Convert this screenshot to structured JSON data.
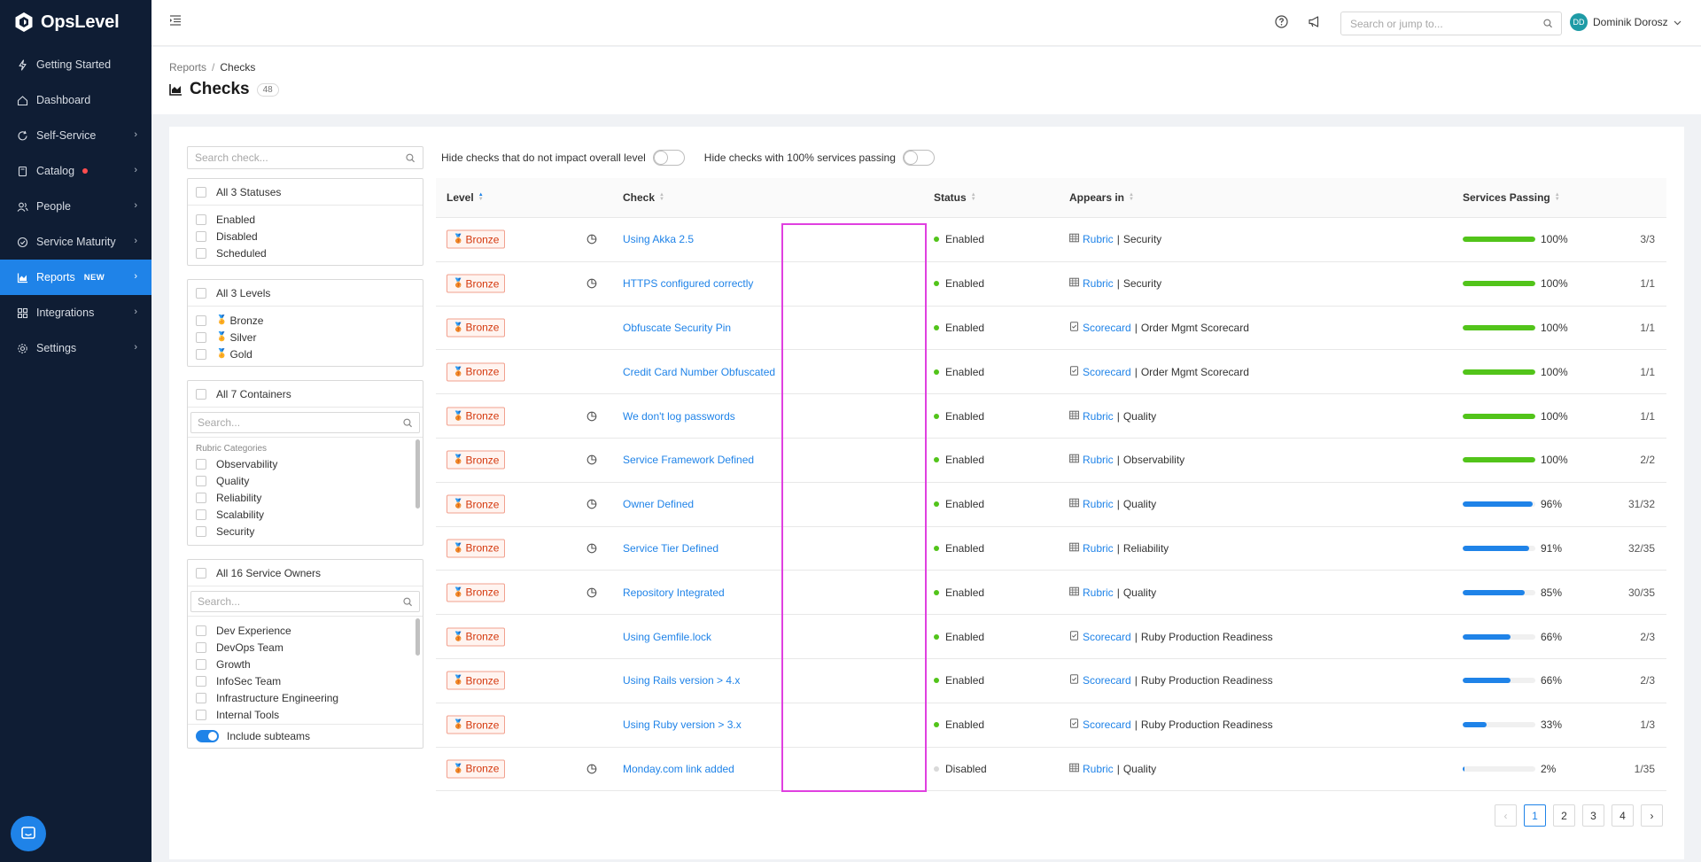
{
  "app": {
    "name": "OpsLevel"
  },
  "sidebar": {
    "items": [
      {
        "label": "Getting Started",
        "icon": "bolt-icon",
        "chevron": false
      },
      {
        "label": "Dashboard",
        "icon": "home-icon",
        "chevron": false
      },
      {
        "label": "Self-Service",
        "icon": "refresh-icon",
        "chevron": true
      },
      {
        "label": "Catalog",
        "icon": "book-icon",
        "chevron": true,
        "dot": true
      },
      {
        "label": "People",
        "icon": "people-icon",
        "chevron": true
      },
      {
        "label": "Service Maturity",
        "icon": "target-icon",
        "chevron": true
      },
      {
        "label": "Reports",
        "icon": "chart-icon",
        "chevron": true,
        "active": true,
        "badge": "NEW"
      },
      {
        "label": "Integrations",
        "icon": "grid-icon",
        "chevron": true
      },
      {
        "label": "Settings",
        "icon": "gear-icon",
        "chevron": true
      }
    ]
  },
  "topbar": {
    "search_placeholder": "Search or jump to...",
    "user_initials": "DD",
    "user_name": "Dominik Dorosz"
  },
  "header": {
    "breadcrumb_parent": "Reports",
    "breadcrumb_separator": "/",
    "breadcrumb_current": "Checks",
    "title": "Checks",
    "count": "48"
  },
  "filters": {
    "search_placeholder": "Search check...",
    "statuses": {
      "all_label": "All 3 Statuses",
      "options": [
        "Enabled",
        "Disabled",
        "Scheduled"
      ]
    },
    "levels": {
      "all_label": "All 3 Levels",
      "options": [
        "Bronze",
        "Silver",
        "Gold"
      ]
    },
    "containers": {
      "all_label": "All 7 Containers",
      "search_placeholder": "Search...",
      "group_label": "Rubric Categories",
      "options": [
        "Observability",
        "Quality",
        "Reliability",
        "Scalability",
        "Security"
      ]
    },
    "owners": {
      "all_label": "All 16 Service Owners",
      "search_placeholder": "Search...",
      "options": [
        "Dev Experience",
        "DevOps Team",
        "Growth",
        "InfoSec Team",
        "Infrastructure Engineering",
        "Internal Tools"
      ],
      "subteams_label": "Include subteams"
    }
  },
  "toggles": {
    "hide_non_impacting": "Hide checks that do not impact overall level",
    "hide_full_passing": "Hide checks with 100% services passing"
  },
  "table": {
    "columns": {
      "level": "Level",
      "check": "Check",
      "status": "Status",
      "appears_in": "Appears in",
      "services_passing": "Services Passing"
    },
    "rows": [
      {
        "level": "Bronze",
        "pie": true,
        "check": "Using Akka 2.5",
        "status": "Enabled",
        "container_type": "Rubric",
        "container": "Security",
        "percent": 100,
        "percent_label": "100%",
        "fraction": "3/3"
      },
      {
        "level": "Bronze",
        "pie": true,
        "check": "HTTPS configured correctly",
        "status": "Enabled",
        "container_type": "Rubric",
        "container": "Security",
        "percent": 100,
        "percent_label": "100%",
        "fraction": "1/1"
      },
      {
        "level": "Bronze",
        "pie": false,
        "check": "Obfuscate Security Pin",
        "status": "Enabled",
        "container_type": "Scorecard",
        "container": "Order Mgmt Scorecard",
        "percent": 100,
        "percent_label": "100%",
        "fraction": "1/1"
      },
      {
        "level": "Bronze",
        "pie": false,
        "check": "Credit Card Number Obfuscated",
        "status": "Enabled",
        "container_type": "Scorecard",
        "container": "Order Mgmt Scorecard",
        "percent": 100,
        "percent_label": "100%",
        "fraction": "1/1"
      },
      {
        "level": "Bronze",
        "pie": true,
        "check": "We don't log passwords",
        "status": "Enabled",
        "container_type": "Rubric",
        "container": "Quality",
        "percent": 100,
        "percent_label": "100%",
        "fraction": "1/1"
      },
      {
        "level": "Bronze",
        "pie": true,
        "check": "Service Framework Defined",
        "status": "Enabled",
        "container_type": "Rubric",
        "container": "Observability",
        "percent": 100,
        "percent_label": "100%",
        "fraction": "2/2"
      },
      {
        "level": "Bronze",
        "pie": true,
        "check": "Owner Defined",
        "status": "Enabled",
        "container_type": "Rubric",
        "container": "Quality",
        "percent": 96,
        "percent_label": "96%",
        "fraction": "31/32"
      },
      {
        "level": "Bronze",
        "pie": true,
        "check": "Service Tier Defined",
        "status": "Enabled",
        "container_type": "Rubric",
        "container": "Reliability",
        "percent": 91,
        "percent_label": "91%",
        "fraction": "32/35"
      },
      {
        "level": "Bronze",
        "pie": true,
        "check": "Repository Integrated",
        "status": "Enabled",
        "container_type": "Rubric",
        "container": "Quality",
        "percent": 85,
        "percent_label": "85%",
        "fraction": "30/35"
      },
      {
        "level": "Bronze",
        "pie": false,
        "check": "Using Gemfile.lock",
        "status": "Enabled",
        "container_type": "Scorecard",
        "container": "Ruby Production Readiness",
        "percent": 66,
        "percent_label": "66%",
        "fraction": "2/3"
      },
      {
        "level": "Bronze",
        "pie": false,
        "check": "Using Rails version > 4.x",
        "status": "Enabled",
        "container_type": "Scorecard",
        "container": "Ruby Production Readiness",
        "percent": 66,
        "percent_label": "66%",
        "fraction": "2/3"
      },
      {
        "level": "Bronze",
        "pie": false,
        "check": "Using Ruby version > 3.x",
        "status": "Enabled",
        "container_type": "Scorecard",
        "container": "Ruby Production Readiness",
        "percent": 33,
        "percent_label": "33%",
        "fraction": "1/3"
      },
      {
        "level": "Bronze",
        "pie": true,
        "check": "Monday.com link added",
        "status": "Disabled",
        "container_type": "Rubric",
        "container": "Quality",
        "percent": 2,
        "percent_label": "2%",
        "fraction": "1/35"
      }
    ]
  },
  "pagination": {
    "pages": [
      "1",
      "2",
      "3",
      "4"
    ],
    "current": "1"
  },
  "colors": {
    "accent": "#1f83e8",
    "sidebar_bg": "#0f1d34",
    "pass_full": "#52c41a",
    "pass_partial": "#1f83e8",
    "enabled_dot": "#52c41a",
    "disabled_dot": "#d9d9d9",
    "highlight": "#e040e0"
  }
}
